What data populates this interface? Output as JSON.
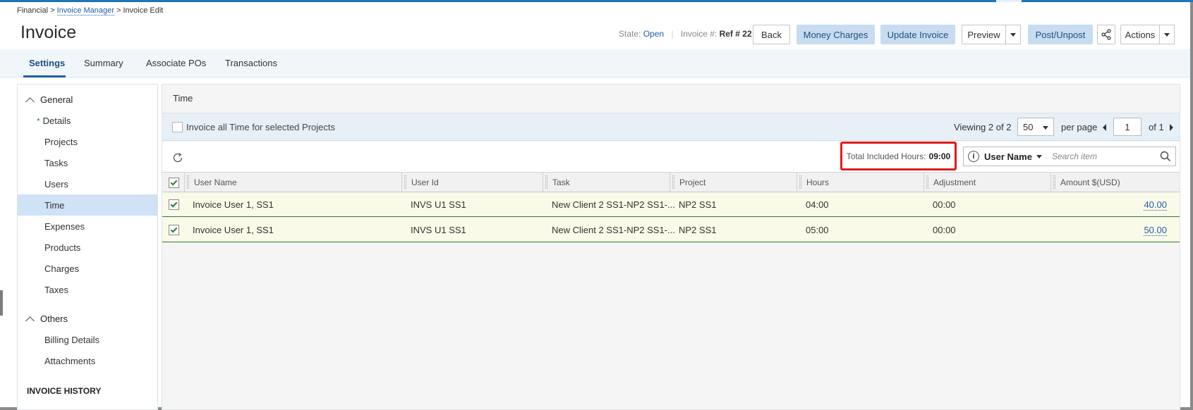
{
  "breadcrumb": {
    "part1": "Financial",
    "sep1": ">",
    "part2": "Invoice Manager",
    "sep2": ">",
    "part3": "Invoice Edit"
  },
  "header": {
    "title": "Invoice",
    "state_label": "State:",
    "state_value": "Open",
    "invoice_label": "Invoice #:",
    "invoice_value": "Ref # 22"
  },
  "buttons": {
    "back": "Back",
    "money_charges": "Money Charges",
    "update_invoice": "Update Invoice",
    "preview": "Preview",
    "post_unpost": "Post/Unpost",
    "actions": "Actions"
  },
  "tabs": [
    {
      "label": "Settings",
      "active": true
    },
    {
      "label": "Summary",
      "active": false
    },
    {
      "label": "Associate POs",
      "active": false
    },
    {
      "label": "Transactions",
      "active": false
    }
  ],
  "leftnav": {
    "general_label": "General",
    "general_items": [
      "Details",
      "Projects",
      "Tasks",
      "Users",
      "Time",
      "Expenses",
      "Products",
      "Charges",
      "Taxes"
    ],
    "active_item": "Time",
    "others_label": "Others",
    "others_items": [
      "Billing Details",
      "Attachments"
    ],
    "history_label": "INVOICE HISTORY"
  },
  "panel": {
    "title": "Time",
    "invoice_all_label": "Invoice all Time for selected Projects",
    "viewing_label": "Viewing",
    "viewing_value": "2 of 2",
    "per_page_value": "50",
    "per_page_label": "per page",
    "page_value": "1",
    "of_label": "of 1",
    "total_label": "Total Included Hours:",
    "total_value": "09:00",
    "filter_label": "User Name",
    "search_placeholder": "Search item"
  },
  "grid": {
    "columns": [
      "User Name",
      "User Id",
      "Task",
      "Project",
      "Hours",
      "Adjustment",
      "Amount $(USD)"
    ],
    "rows": [
      {
        "user_name": "Invoice User 1, SS1",
        "user_id": "INVS U1 SS1",
        "task": "New Client 2 SS1-NP2 SS1-...",
        "project": "NP2 SS1",
        "hours": "04:00",
        "adjustment": "00:00",
        "amount": "40.00",
        "checked": true
      },
      {
        "user_name": "Invoice User 1, SS1",
        "user_id": "INVS U1 SS1",
        "task": "New Client 2 SS1-NP2 SS1-...",
        "project": "NP2 SS1",
        "hours": "05:00",
        "adjustment": "00:00",
        "amount": "50.00",
        "checked": true
      }
    ]
  },
  "colors": {
    "accent_blue": "#1f5fa8",
    "button_blue": "#c7dcf0",
    "highlight_red": "#e01b1b",
    "row_bg": "#fafae8",
    "row_border": "#2e7d32"
  },
  "icons": {
    "share": "share-icon",
    "refresh": "refresh-icon",
    "info": "info-icon",
    "search": "search-icon"
  }
}
